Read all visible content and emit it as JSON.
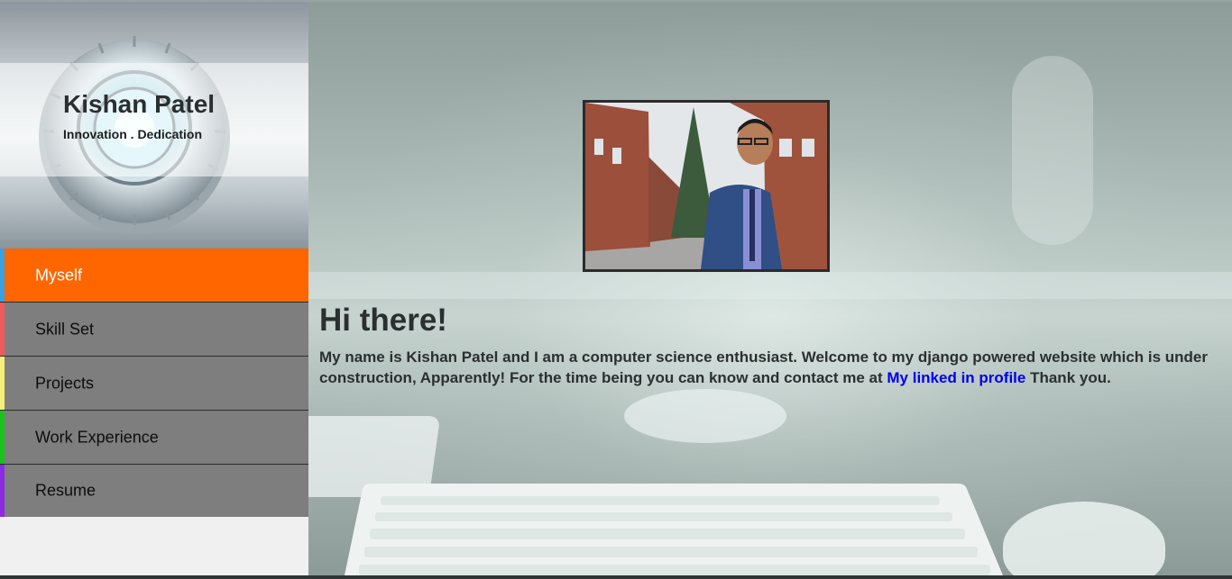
{
  "site": {
    "title": "Kishan Patel",
    "tagline": "Innovation . Dedication"
  },
  "nav": {
    "items": [
      {
        "label": "Myself",
        "active": true,
        "stripe_color": "#3ba0e0"
      },
      {
        "label": "Skill Set",
        "active": false,
        "stripe_color": "#f05a5a"
      },
      {
        "label": "Projects",
        "active": false,
        "stripe_color": "#f4f07a"
      },
      {
        "label": "Work Experience",
        "active": false,
        "stripe_color": "#18c41c"
      },
      {
        "label": "Resume",
        "active": false,
        "stripe_color": "#8a2be2"
      }
    ],
    "active_color": "#ff6600",
    "inactive_color": "#7e7e7e"
  },
  "main": {
    "heading": "Hi there!",
    "intro_text": "My name is Kishan Patel and I am a computer science enthusiast. Welcome to my django powered website which is under construction, Apparently! For the time being you can know and contact me at ",
    "link_label": "My linked in profile",
    "outro_text": " Thank you.",
    "link_color": "#0000ee"
  }
}
